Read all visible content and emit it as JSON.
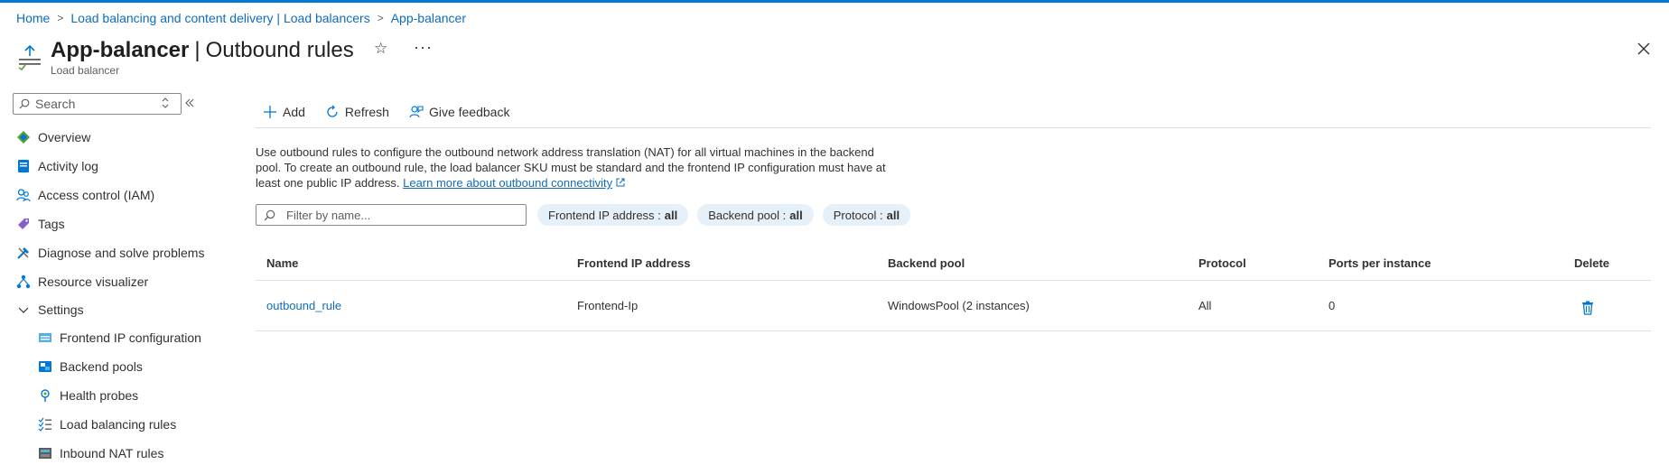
{
  "breadcrumb": {
    "home": "Home",
    "parent": "Load balancing and content delivery | Load balancers",
    "current": "App-balancer"
  },
  "header": {
    "resource_name": "App-balancer",
    "separator": "|",
    "page_name": "Outbound rules",
    "subtitle": "Load balancer",
    "favorite_icon": "star-icon",
    "more_label": "···"
  },
  "sidebar": {
    "search_placeholder": "Search",
    "items": [
      {
        "label": "Overview",
        "icon": "overview-icon"
      },
      {
        "label": "Activity log",
        "icon": "activity-log-icon"
      },
      {
        "label": "Access control (IAM)",
        "icon": "iam-icon"
      },
      {
        "label": "Tags",
        "icon": "tag-icon"
      },
      {
        "label": "Diagnose and solve problems",
        "icon": "diagnose-icon"
      },
      {
        "label": "Resource visualizer",
        "icon": "visualizer-icon"
      },
      {
        "label": "Settings",
        "icon": "chevron-down-icon"
      },
      {
        "label": "Frontend IP configuration",
        "icon": "frontend-ip-icon"
      },
      {
        "label": "Backend pools",
        "icon": "backend-pool-icon"
      },
      {
        "label": "Health probes",
        "icon": "health-probe-icon"
      },
      {
        "label": "Load balancing rules",
        "icon": "lb-rules-icon"
      },
      {
        "label": "Inbound NAT rules",
        "icon": "inbound-nat-icon"
      }
    ]
  },
  "toolbar": {
    "add_label": "Add",
    "refresh_label": "Refresh",
    "feedback_label": "Give feedback"
  },
  "description": {
    "text": "Use outbound rules to configure the outbound network address translation (NAT) for all virtual machines in the backend pool. To create an outbound rule, the load balancer SKU must be standard and the frontend IP configuration must have at least one public IP address.",
    "link": "Learn more about outbound connectivity"
  },
  "filters": {
    "placeholder": "Filter by name...",
    "frontend_label": "Frontend IP address :",
    "frontend_value": "all",
    "backend_label": "Backend pool :",
    "backend_value": "all",
    "protocol_label": "Protocol :",
    "protocol_value": "all"
  },
  "table": {
    "columns": [
      "Name",
      "Frontend IP address",
      "Backend pool",
      "Protocol",
      "Ports per instance",
      "Delete"
    ],
    "rows": [
      {
        "name": "outbound_rule",
        "frontend": "Frontend-Ip",
        "backend": "WindowsPool (2 instances)",
        "protocol": "All",
        "ports": "0"
      }
    ]
  },
  "colors": {
    "accent": "#0078d4",
    "link": "#0f6cbd",
    "pill_bg": "#e6f0f9"
  }
}
